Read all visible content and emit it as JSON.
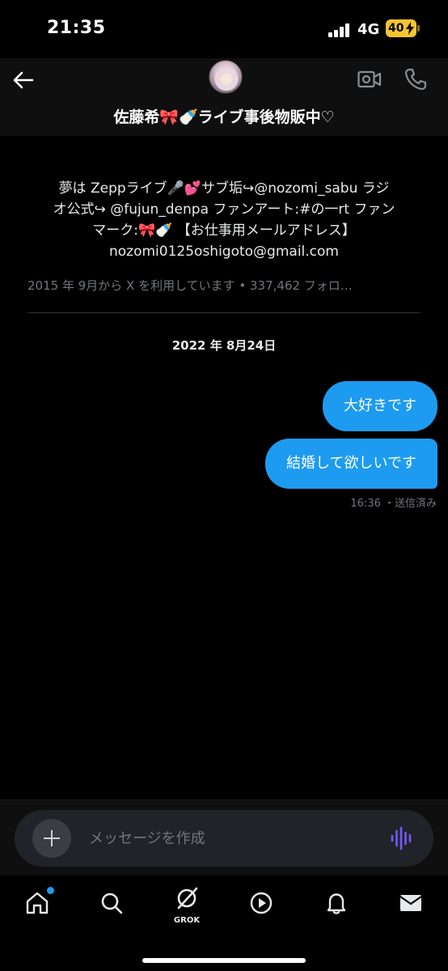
{
  "status_bar": {
    "time": "21:35",
    "network": "4G",
    "battery": "40"
  },
  "header": {
    "title": "佐藤希🎀🍼ライブ事後物販中♡"
  },
  "profile": {
    "bio_lines": [
      "夢は Zeppライブ🎤💕サブ垢↪@nozomi_sabu ラジ",
      "オ公式↪ @fujun_denpa ファンアート:#の一rt ファン",
      "マーク:🎀🍼 【お仕事用メールアドレス】",
      "nozomi0125oshigoto@gmail.com"
    ],
    "joined": "2015 年 9月から X を利用しています • 337,462 フォロ…"
  },
  "conversation": {
    "date": "2022 年 8月24日",
    "messages": [
      {
        "text": "大好きです",
        "sender": "me"
      },
      {
        "text": "結婚して欲しいです",
        "sender": "me"
      }
    ],
    "meta": "16:36 ・送信済み"
  },
  "composer": {
    "placeholder": "メッセージを作成"
  },
  "nav": {
    "grok_label": "GROK"
  },
  "colors": {
    "accent": "#1d9bf0",
    "background": "#000000",
    "battery": "#f4c430",
    "voice_icon": "#7856ff"
  },
  "icons": [
    "back-arrow-icon",
    "video-call-icon",
    "phone-icon",
    "plus-icon",
    "voice-wave-icon",
    "home-icon",
    "search-icon",
    "grok-icon",
    "play-icon",
    "bell-icon",
    "mail-icon"
  ]
}
